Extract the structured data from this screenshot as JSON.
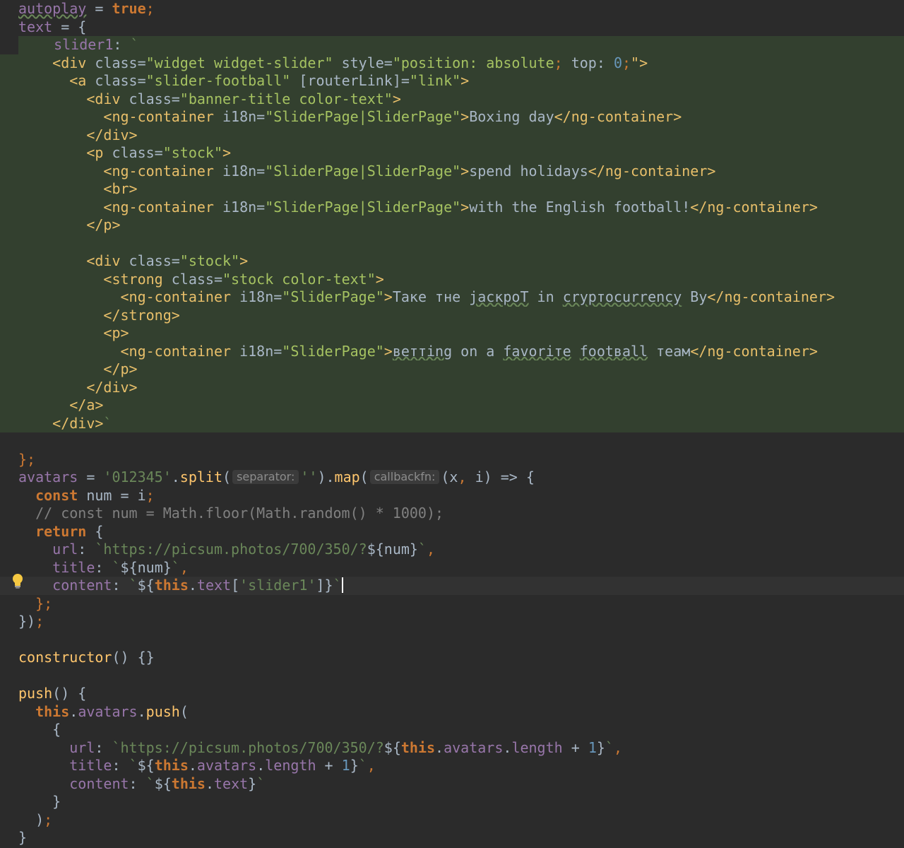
{
  "editor": {
    "colors": {
      "background": "#2b2b2b",
      "template_block": "#33402f",
      "current_line": "#323232",
      "keyword": "#cc7832",
      "string": "#6a8759",
      "tag": "#e8bf6a",
      "attr_value": "#a5c261",
      "property": "#9876aa",
      "function": "#ffc66d",
      "number": "#6897bb",
      "comment": "#808080",
      "text": "#a9b7c6"
    },
    "lines": [
      [
        {
          "t": "autoplay",
          "c": "property",
          "u": 1
        },
        {
          "t": " = ",
          "c": "text"
        },
        {
          "t": "true",
          "c": "keyword"
        },
        {
          "t": ";",
          "c": "keyword"
        }
      ],
      [
        {
          "t": "text",
          "c": "property"
        },
        {
          "t": " = {",
          "c": "text"
        }
      ],
      [
        {
          "t": "  slider1",
          "c": "property"
        },
        {
          "t": ": ",
          "c": "text"
        },
        {
          "t": "`",
          "c": "string"
        }
      ],
      [
        {
          "t": "    ",
          "c": "text"
        },
        {
          "t": "<div ",
          "c": "tag"
        },
        {
          "t": "class=",
          "c": "text"
        },
        {
          "t": "\"widget widget-slider\"",
          "c": "attr_value"
        },
        {
          "t": " style=",
          "c": "text"
        },
        {
          "t": "\"position: ",
          "c": "attr_value"
        },
        {
          "t": "absolute",
          "c": "attr_value"
        },
        {
          "t": "; ",
          "c": "keyword"
        },
        {
          "t": "top",
          "c": "text"
        },
        {
          "t": ": ",
          "c": "text"
        },
        {
          "t": "0",
          "c": "number"
        },
        {
          "t": ";",
          "c": "keyword"
        },
        {
          "t": "\">",
          "c": "tag"
        }
      ],
      [
        {
          "t": "      ",
          "c": "text"
        },
        {
          "t": "<a ",
          "c": "tag"
        },
        {
          "t": "class=",
          "c": "text"
        },
        {
          "t": "\"slider-football\"",
          "c": "attr_value"
        },
        {
          "t": " [routerLink]=",
          "c": "text"
        },
        {
          "t": "\"link\"",
          "c": "attr_value"
        },
        {
          "t": ">",
          "c": "tag"
        }
      ],
      [
        {
          "t": "        ",
          "c": "text"
        },
        {
          "t": "<div ",
          "c": "tag"
        },
        {
          "t": "class=",
          "c": "text"
        },
        {
          "t": "\"banner-title color-text\"",
          "c": "attr_value"
        },
        {
          "t": ">",
          "c": "tag"
        }
      ],
      [
        {
          "t": "          ",
          "c": "text"
        },
        {
          "t": "<ng-container ",
          "c": "tag"
        },
        {
          "t": "i18n=",
          "c": "text"
        },
        {
          "t": "\"SliderPage|SliderPage\"",
          "c": "attr_value"
        },
        {
          "t": ">",
          "c": "tag"
        },
        {
          "t": "Boxing day",
          "c": "text"
        },
        {
          "t": "</ng-container>",
          "c": "tag"
        }
      ],
      [
        {
          "t": "        ",
          "c": "text"
        },
        {
          "t": "</div>",
          "c": "tag"
        }
      ],
      [
        {
          "t": "        ",
          "c": "text"
        },
        {
          "t": "<p ",
          "c": "tag"
        },
        {
          "t": "class=",
          "c": "text"
        },
        {
          "t": "\"stock\"",
          "c": "attr_value"
        },
        {
          "t": ">",
          "c": "tag"
        }
      ],
      [
        {
          "t": "          ",
          "c": "text"
        },
        {
          "t": "<ng-container ",
          "c": "tag"
        },
        {
          "t": "i18n=",
          "c": "text"
        },
        {
          "t": "\"SliderPage|SliderPage\"",
          "c": "attr_value"
        },
        {
          "t": ">",
          "c": "tag"
        },
        {
          "t": "spend holidays",
          "c": "text"
        },
        {
          "t": "</ng-container>",
          "c": "tag"
        }
      ],
      [
        {
          "t": "          ",
          "c": "text"
        },
        {
          "t": "<br>",
          "c": "tag"
        }
      ],
      [
        {
          "t": "          ",
          "c": "text"
        },
        {
          "t": "<ng-container ",
          "c": "tag"
        },
        {
          "t": "i18n=",
          "c": "text"
        },
        {
          "t": "\"SliderPage|SliderPage\"",
          "c": "attr_value"
        },
        {
          "t": ">",
          "c": "tag"
        },
        {
          "t": "with the English football!",
          "c": "text"
        },
        {
          "t": "</ng-container>",
          "c": "tag"
        }
      ],
      [
        {
          "t": "        ",
          "c": "text"
        },
        {
          "t": "</p>",
          "c": "tag"
        }
      ],
      [],
      [
        {
          "t": "        ",
          "c": "text"
        },
        {
          "t": "<div ",
          "c": "tag"
        },
        {
          "t": "class=",
          "c": "text"
        },
        {
          "t": "\"stock\"",
          "c": "attr_value"
        },
        {
          "t": ">",
          "c": "tag"
        }
      ],
      [
        {
          "t": "          ",
          "c": "text"
        },
        {
          "t": "<strong ",
          "c": "tag"
        },
        {
          "t": "class=",
          "c": "text"
        },
        {
          "t": "\"stock color-text\"",
          "c": "attr_value"
        },
        {
          "t": ">",
          "c": "tag"
        }
      ],
      [
        {
          "t": "            ",
          "c": "text"
        },
        {
          "t": "<ng-container ",
          "c": "tag"
        },
        {
          "t": "i18n=",
          "c": "text"
        },
        {
          "t": "\"SliderPage\"",
          "c": "attr_value"
        },
        {
          "t": ">",
          "c": "tag"
        },
        {
          "t": "Таке тнe ",
          "c": "text"
        },
        {
          "t": "jаскроТ",
          "c": "text",
          "u": 1
        },
        {
          "t": " in ",
          "c": "text"
        },
        {
          "t": "сryртосurrеnсу",
          "c": "text",
          "u": 1
        },
        {
          "t": " Ву",
          "c": "text"
        },
        {
          "t": "</ng-container>",
          "c": "tag"
        }
      ],
      [
        {
          "t": "          ",
          "c": "text"
        },
        {
          "t": "</strong>",
          "c": "tag"
        }
      ],
      [
        {
          "t": "          ",
          "c": "text"
        },
        {
          "t": "<p>",
          "c": "tag"
        }
      ],
      [
        {
          "t": "            ",
          "c": "text"
        },
        {
          "t": "<ng-container ",
          "c": "tag"
        },
        {
          "t": "i18n=",
          "c": "text"
        },
        {
          "t": "\"SliderPage\"",
          "c": "attr_value"
        },
        {
          "t": ">",
          "c": "tag"
        },
        {
          "t": "вeттing",
          "c": "text",
          "u": 1
        },
        {
          "t": " on a ",
          "c": "text"
        },
        {
          "t": "favoriтe",
          "c": "text",
          "u": 1
        },
        {
          "t": " ",
          "c": "text"
        },
        {
          "t": "footвall",
          "c": "text",
          "u": 1
        },
        {
          "t": " тeaм",
          "c": "text"
        },
        {
          "t": "</ng-container>",
          "c": "tag"
        }
      ],
      [
        {
          "t": "          ",
          "c": "text"
        },
        {
          "t": "</p>",
          "c": "tag"
        }
      ],
      [
        {
          "t": "        ",
          "c": "text"
        },
        {
          "t": "</div>",
          "c": "tag"
        }
      ],
      [
        {
          "t": "      ",
          "c": "text"
        },
        {
          "t": "</a>",
          "c": "tag"
        }
      ],
      [
        {
          "t": "    ",
          "c": "text"
        },
        {
          "t": "</div>",
          "c": "tag"
        },
        {
          "t": "`",
          "c": "string"
        }
      ],
      [],
      [
        {
          "t": "};",
          "c": "keyword"
        }
      ],
      [
        {
          "t": "avatars",
          "c": "property"
        },
        {
          "t": " = ",
          "c": "text"
        },
        {
          "t": "'012345'",
          "c": "string"
        },
        {
          "t": ".",
          "c": "text"
        },
        {
          "t": "split",
          "c": "function"
        },
        {
          "t": "(",
          "c": "text"
        },
        {
          "h": "separator:"
        },
        {
          "t": "''",
          "c": "string"
        },
        {
          "t": ").",
          "c": "text"
        },
        {
          "t": "map",
          "c": "function"
        },
        {
          "t": "(",
          "c": "text"
        },
        {
          "h": "callbackfn:"
        },
        {
          "t": "(x",
          "c": "text"
        },
        {
          "t": ",",
          "c": "keyword"
        },
        {
          "t": " i) => {",
          "c": "text"
        }
      ],
      [
        {
          "t": "  ",
          "c": "text"
        },
        {
          "t": "const",
          "c": "keyword"
        },
        {
          "t": " num = i",
          "c": "text"
        },
        {
          "t": ";",
          "c": "keyword"
        }
      ],
      [
        {
          "t": "  // const num = Math.floor(Math.random() * 1000);",
          "c": "comment"
        }
      ],
      [
        {
          "t": "  ",
          "c": "text"
        },
        {
          "t": "return",
          "c": "keyword"
        },
        {
          "t": " {",
          "c": "text"
        }
      ],
      [
        {
          "t": "    ",
          "c": "text"
        },
        {
          "t": "url",
          "c": "property"
        },
        {
          "t": ": ",
          "c": "text"
        },
        {
          "t": "`https://picsum.photos/700/350/?",
          "c": "string"
        },
        {
          "t": "${num}",
          "c": "text"
        },
        {
          "t": "`",
          "c": "string"
        },
        {
          "t": ",",
          "c": "keyword"
        }
      ],
      [
        {
          "t": "    ",
          "c": "text"
        },
        {
          "t": "title",
          "c": "property"
        },
        {
          "t": ": ",
          "c": "text"
        },
        {
          "t": "`",
          "c": "string"
        },
        {
          "t": "${num}",
          "c": "text"
        },
        {
          "t": "`",
          "c": "string"
        },
        {
          "t": ",",
          "c": "keyword"
        }
      ],
      [
        {
          "t": "    ",
          "c": "text"
        },
        {
          "t": "content",
          "c": "property"
        },
        {
          "t": ": ",
          "c": "text"
        },
        {
          "t": "`",
          "c": "string"
        },
        {
          "t": "${",
          "c": "text"
        },
        {
          "t": "this",
          "c": "keyword"
        },
        {
          "t": ".",
          "c": "text"
        },
        {
          "t": "text",
          "c": "property"
        },
        {
          "t": "[",
          "c": "text"
        },
        {
          "t": "'slider1'",
          "c": "string"
        },
        {
          "t": "]}",
          "c": "text"
        },
        {
          "t": "`",
          "c": "string"
        },
        {
          "caret": 1
        }
      ],
      [
        {
          "t": "  };",
          "c": "keyword"
        }
      ],
      [
        {
          "t": "})",
          "c": "text"
        },
        {
          "t": ";",
          "c": "keyword"
        }
      ],
      [],
      [
        {
          "t": "constructor",
          "c": "function"
        },
        {
          "t": "() {}",
          "c": "text"
        }
      ],
      [],
      [
        {
          "t": "push",
          "c": "function"
        },
        {
          "t": "() {",
          "c": "text"
        }
      ],
      [
        {
          "t": "  ",
          "c": "text"
        },
        {
          "t": "this",
          "c": "keyword"
        },
        {
          "t": ".",
          "c": "text"
        },
        {
          "t": "avatars",
          "c": "property"
        },
        {
          "t": ".",
          "c": "text"
        },
        {
          "t": "push",
          "c": "function"
        },
        {
          "t": "(",
          "c": "text"
        }
      ],
      [
        {
          "t": "    {",
          "c": "text"
        }
      ],
      [
        {
          "t": "      ",
          "c": "text"
        },
        {
          "t": "url",
          "c": "property"
        },
        {
          "t": ": ",
          "c": "text"
        },
        {
          "t": "`https://picsum.photos/700/350/?",
          "c": "string"
        },
        {
          "t": "${",
          "c": "text"
        },
        {
          "t": "this",
          "c": "keyword"
        },
        {
          "t": ".",
          "c": "text"
        },
        {
          "t": "avatars",
          "c": "property"
        },
        {
          "t": ".",
          "c": "text"
        },
        {
          "t": "length",
          "c": "property"
        },
        {
          "t": " + ",
          "c": "text"
        },
        {
          "t": "1",
          "c": "number"
        },
        {
          "t": "}",
          "c": "text"
        },
        {
          "t": "`",
          "c": "string"
        },
        {
          "t": ",",
          "c": "keyword"
        }
      ],
      [
        {
          "t": "      ",
          "c": "text"
        },
        {
          "t": "title",
          "c": "property"
        },
        {
          "t": ": ",
          "c": "text"
        },
        {
          "t": "`",
          "c": "string"
        },
        {
          "t": "${",
          "c": "text"
        },
        {
          "t": "this",
          "c": "keyword"
        },
        {
          "t": ".",
          "c": "text"
        },
        {
          "t": "avatars",
          "c": "property"
        },
        {
          "t": ".",
          "c": "text"
        },
        {
          "t": "length",
          "c": "property"
        },
        {
          "t": " + ",
          "c": "text"
        },
        {
          "t": "1",
          "c": "number"
        },
        {
          "t": "}",
          "c": "text"
        },
        {
          "t": "`",
          "c": "string"
        },
        {
          "t": ",",
          "c": "keyword"
        }
      ],
      [
        {
          "t": "      ",
          "c": "text"
        },
        {
          "t": "content",
          "c": "property"
        },
        {
          "t": ": ",
          "c": "text"
        },
        {
          "t": "`",
          "c": "string"
        },
        {
          "t": "${",
          "c": "text"
        },
        {
          "t": "this",
          "c": "keyword"
        },
        {
          "t": ".",
          "c": "text"
        },
        {
          "t": "text",
          "c": "property"
        },
        {
          "t": "}",
          "c": "text"
        },
        {
          "t": "`",
          "c": "string"
        }
      ],
      [
        {
          "t": "    }",
          "c": "text"
        }
      ],
      [
        {
          "t": "  )",
          "c": "text"
        },
        {
          "t": ";",
          "c": "keyword"
        }
      ],
      [
        {
          "t": "}",
          "c": "text"
        }
      ]
    ]
  }
}
